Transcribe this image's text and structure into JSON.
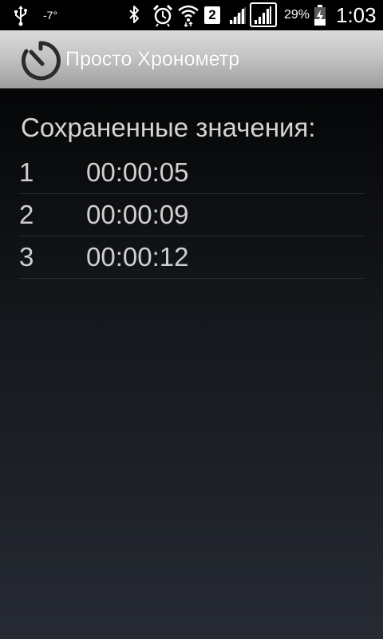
{
  "status_bar": {
    "temperature": "-7°",
    "sim_slot": "2",
    "battery_percent": "29%",
    "time": "1:03",
    "icons": [
      "usb-icon",
      "bluetooth-icon",
      "alarm-icon",
      "wifi-icon",
      "signal-icon",
      "battery-icon"
    ]
  },
  "action_bar": {
    "icon": "stopwatch-icon",
    "title": "Просто Хронометр"
  },
  "main": {
    "header": "Сохраненные значения:",
    "items": [
      {
        "index": "1",
        "value": "00:00:05"
      },
      {
        "index": "2",
        "value": "00:00:09"
      },
      {
        "index": "3",
        "value": "00:00:12"
      }
    ]
  },
  "colors": {
    "action_bar": "#c4c4c4",
    "background_top": "#050607",
    "background_bottom": "#262a33",
    "text": "#cfcfcf"
  }
}
